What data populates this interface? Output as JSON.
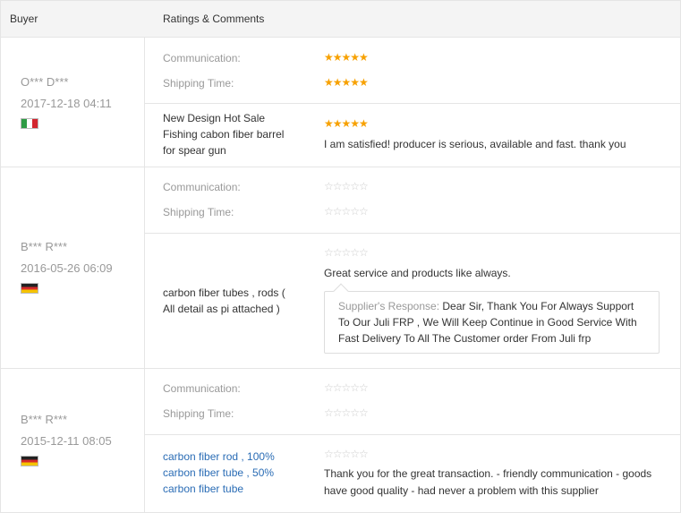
{
  "header": {
    "buyer": "Buyer",
    "ratings": "Ratings & Comments"
  },
  "labels": {
    "communication": "Communication:",
    "shipping": "Shipping Time:"
  },
  "stars": {
    "full": "★★★★★",
    "empty": "☆☆☆☆☆"
  },
  "reviews": [
    {
      "buyer": "O*** D***",
      "date": "2017-12-18 04:11",
      "country_flag": "italy-flag",
      "communication_stars": 5,
      "shipping_stars": 5,
      "product_lines": [
        "New Design Hot Sale",
        "Fishing cabon fiber barrel",
        "for spear gun"
      ],
      "product_stars": 5,
      "comment": "I am satisfied! producer is serious, available and fast. thank you"
    },
    {
      "buyer": "B*** R***",
      "date": "2016-05-26 06:09",
      "country_flag": "germany-flag",
      "communication_stars": 0,
      "shipping_stars": 0,
      "product_lines": [
        "carbon fiber tubes , rods (",
        "All detail as pi attached )"
      ],
      "product_stars": 0,
      "comment": "Great service and products like always.",
      "supplier_response_label": "Supplier's Response:",
      "supplier_response_lines": [
        " Dear Sir, Thank You For Always Support",
        "To Our Juli FRP , We Will Keep Continue in Good Service With",
        "Fast Delivery To All The Customer order From Juli frp"
      ]
    },
    {
      "buyer": "B*** R***",
      "date": "2015-12-11 08:05",
      "country_flag": "germany-flag",
      "communication_stars": 0,
      "shipping_stars": 0,
      "product_lines": [
        "carbon fiber rod , 100%",
        "carbon fiber tube , 50%",
        "carbon fiber tube"
      ],
      "product_stars": 0,
      "comment_lines": [
        "Thank you for the great transaction. - friendly communication - goods",
        "have good quality - had never a problem with this supplier"
      ]
    }
  ],
  "colors": {
    "star_on": "#f7a100",
    "star_off": "#cccccc",
    "link": "#2a6cb5",
    "header_bg": "#f4f4f4"
  }
}
